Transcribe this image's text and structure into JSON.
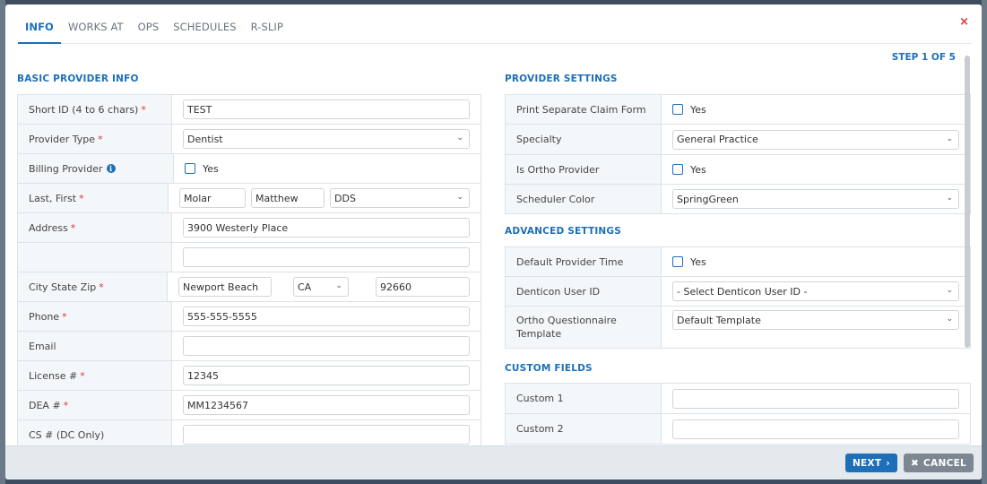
{
  "tabs": [
    {
      "label": "INFO",
      "active": true
    },
    {
      "label": "WORKS AT",
      "active": false
    },
    {
      "label": "OPS",
      "active": false
    },
    {
      "label": "SCHEDULES",
      "active": false
    },
    {
      "label": "R-SLIP",
      "active": false
    }
  ],
  "close_symbol": "×",
  "step_label": "STEP 1 OF 5",
  "basic": {
    "title": "BASIC PROVIDER INFO",
    "short_id": {
      "label": "Short ID (4 to 6 chars)",
      "value": "TEST"
    },
    "provider_type": {
      "label": "Provider Type",
      "value": "Dentist"
    },
    "billing_provider": {
      "label": "Billing Provider",
      "checkbox_label": "Yes"
    },
    "name": {
      "label": "Last, First",
      "last": "Molar",
      "first": "Matthew",
      "suffix": "DDS"
    },
    "address": {
      "label": "Address",
      "line1": "3900 Westerly Place",
      "line2": ""
    },
    "city_state_zip": {
      "label": "City State Zip",
      "city": "Newport Beach",
      "state": "CA",
      "zip": "92660"
    },
    "phone": {
      "label": "Phone",
      "value": "555-555-5555"
    },
    "email": {
      "label": "Email",
      "value": ""
    },
    "license": {
      "label": "License #",
      "value": "12345"
    },
    "dea": {
      "label": "DEA #",
      "value": "MM1234567"
    },
    "cs": {
      "label": "CS # (DC Only)",
      "value": ""
    }
  },
  "provider_settings": {
    "title": "PROVIDER SETTINGS",
    "print_claim": {
      "label": "Print Separate Claim Form",
      "checkbox_label": "Yes"
    },
    "specialty": {
      "label": "Specialty",
      "value": "General Practice"
    },
    "ortho": {
      "label": "Is Ortho Provider",
      "checkbox_label": "Yes"
    },
    "scheduler_color": {
      "label": "Scheduler Color",
      "value": "SpringGreen"
    }
  },
  "advanced_settings": {
    "title": "ADVANCED SETTINGS",
    "default_time": {
      "label": "Default Provider Time",
      "checkbox_label": "Yes"
    },
    "denticon_user": {
      "label": "Denticon User ID",
      "value": "- Select Denticon User ID -"
    },
    "ortho_template": {
      "label": "Ortho Questionnaire Template",
      "value": "Default Template"
    }
  },
  "custom_fields": {
    "title": "CUSTOM FIELDS",
    "custom1": {
      "label": "Custom 1",
      "value": ""
    },
    "custom2": {
      "label": "Custom 2",
      "value": ""
    }
  },
  "footer": {
    "next_label": "NEXT",
    "cancel_label": "CANCEL"
  },
  "required_marker": "*",
  "chevron": "⌄",
  "colors": {
    "accent": "#1d6fb8",
    "required": "#d9363e",
    "cancel": "#7c8792"
  }
}
